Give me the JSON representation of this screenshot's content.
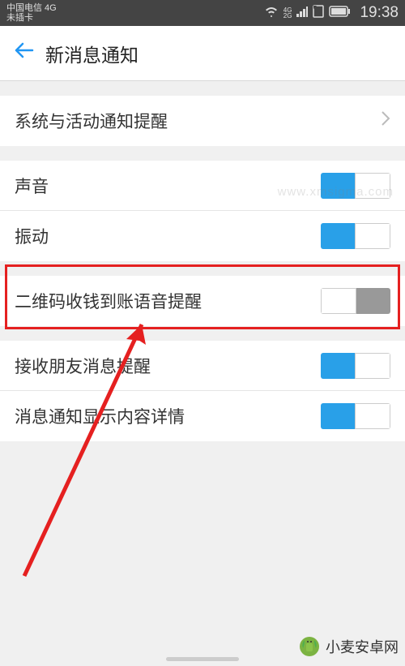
{
  "status_bar": {
    "carrier": "中国电信 4G",
    "sim": "未插卡",
    "net_small_top": "4G",
    "net_small_bottom": "2G",
    "time": "19:38"
  },
  "header": {
    "title": "新消息通知"
  },
  "rows": {
    "system_notify": "系统与活动通知提醒",
    "sound": "声音",
    "vibrate": "振动",
    "qr_voice": "二维码收钱到账语音提醒",
    "friend_msg": "接收朋友消息提醒",
    "show_content": "消息通知显示内容详情"
  },
  "toggles": {
    "sound": true,
    "vibrate": true,
    "qr_voice": false,
    "friend_msg": true,
    "show_content": true
  },
  "watermarks": {
    "xmsigma": "www.xmsigma.com",
    "logo_text": "小麦安卓网"
  }
}
